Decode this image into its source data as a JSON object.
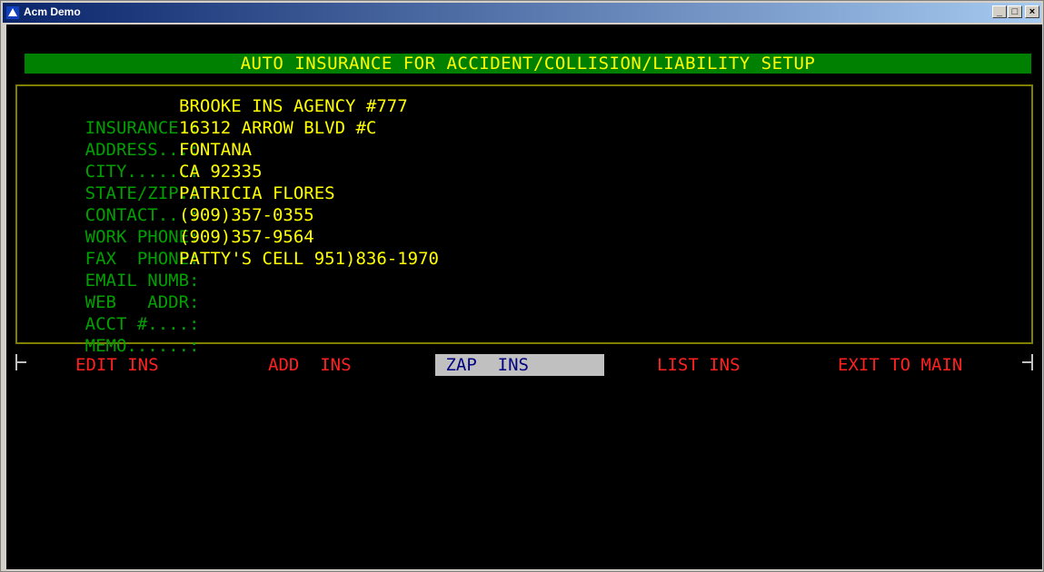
{
  "window": {
    "title": "Acm Demo",
    "icon": "app-icon",
    "controls": {
      "minimize": "_",
      "maximize": "□",
      "close": "×"
    }
  },
  "banner": "AUTO INSURANCE FOR ACCIDENT/COLLISION/LIABILITY SETUP",
  "fields": [
    {
      "label": "INSURANCE.:",
      "value": "BROOKE INS AGENCY #777"
    },
    {
      "label": "ADDRESS...:",
      "value": "16312 ARROW BLVD #C"
    },
    {
      "label": "CITY......:",
      "value": "FONTANA"
    },
    {
      "label": "STATE/ZIP.:",
      "value": "CA 92335"
    },
    {
      "label": "CONTACT...:",
      "value": "PATRICIA FLORES"
    },
    {
      "label": "WORK PHONE:",
      "value": "(909)357-0355"
    },
    {
      "label": "FAX  PHONE:",
      "value": "(909)357-9564"
    },
    {
      "label": "EMAIL NUMB:",
      "value": "PATTY'S CELL 951)836-1970"
    },
    {
      "label": "WEB   ADDR:",
      "value": ""
    },
    {
      "label": "ACCT #....:",
      "value": ""
    },
    {
      "label": "MEMO......:",
      "value": ""
    }
  ],
  "menu": [
    {
      "label": "EDIT INS",
      "selected": false
    },
    {
      "label": "ADD  INS",
      "selected": false
    },
    {
      "label": " ZAP  INS ",
      "selected": true
    },
    {
      "label": "LIST INS",
      "selected": false
    },
    {
      "label": "EXIT TO MAIN",
      "selected": false
    }
  ],
  "colors": {
    "background": "#000000",
    "banner_bg": "#008000",
    "banner_text": "#ffff00",
    "label_text": "#00a000",
    "value_text": "#ffff00",
    "menu_text": "#ff2020",
    "menu_selected_bg": "#c0c0c0",
    "menu_selected_text": "#000080"
  }
}
